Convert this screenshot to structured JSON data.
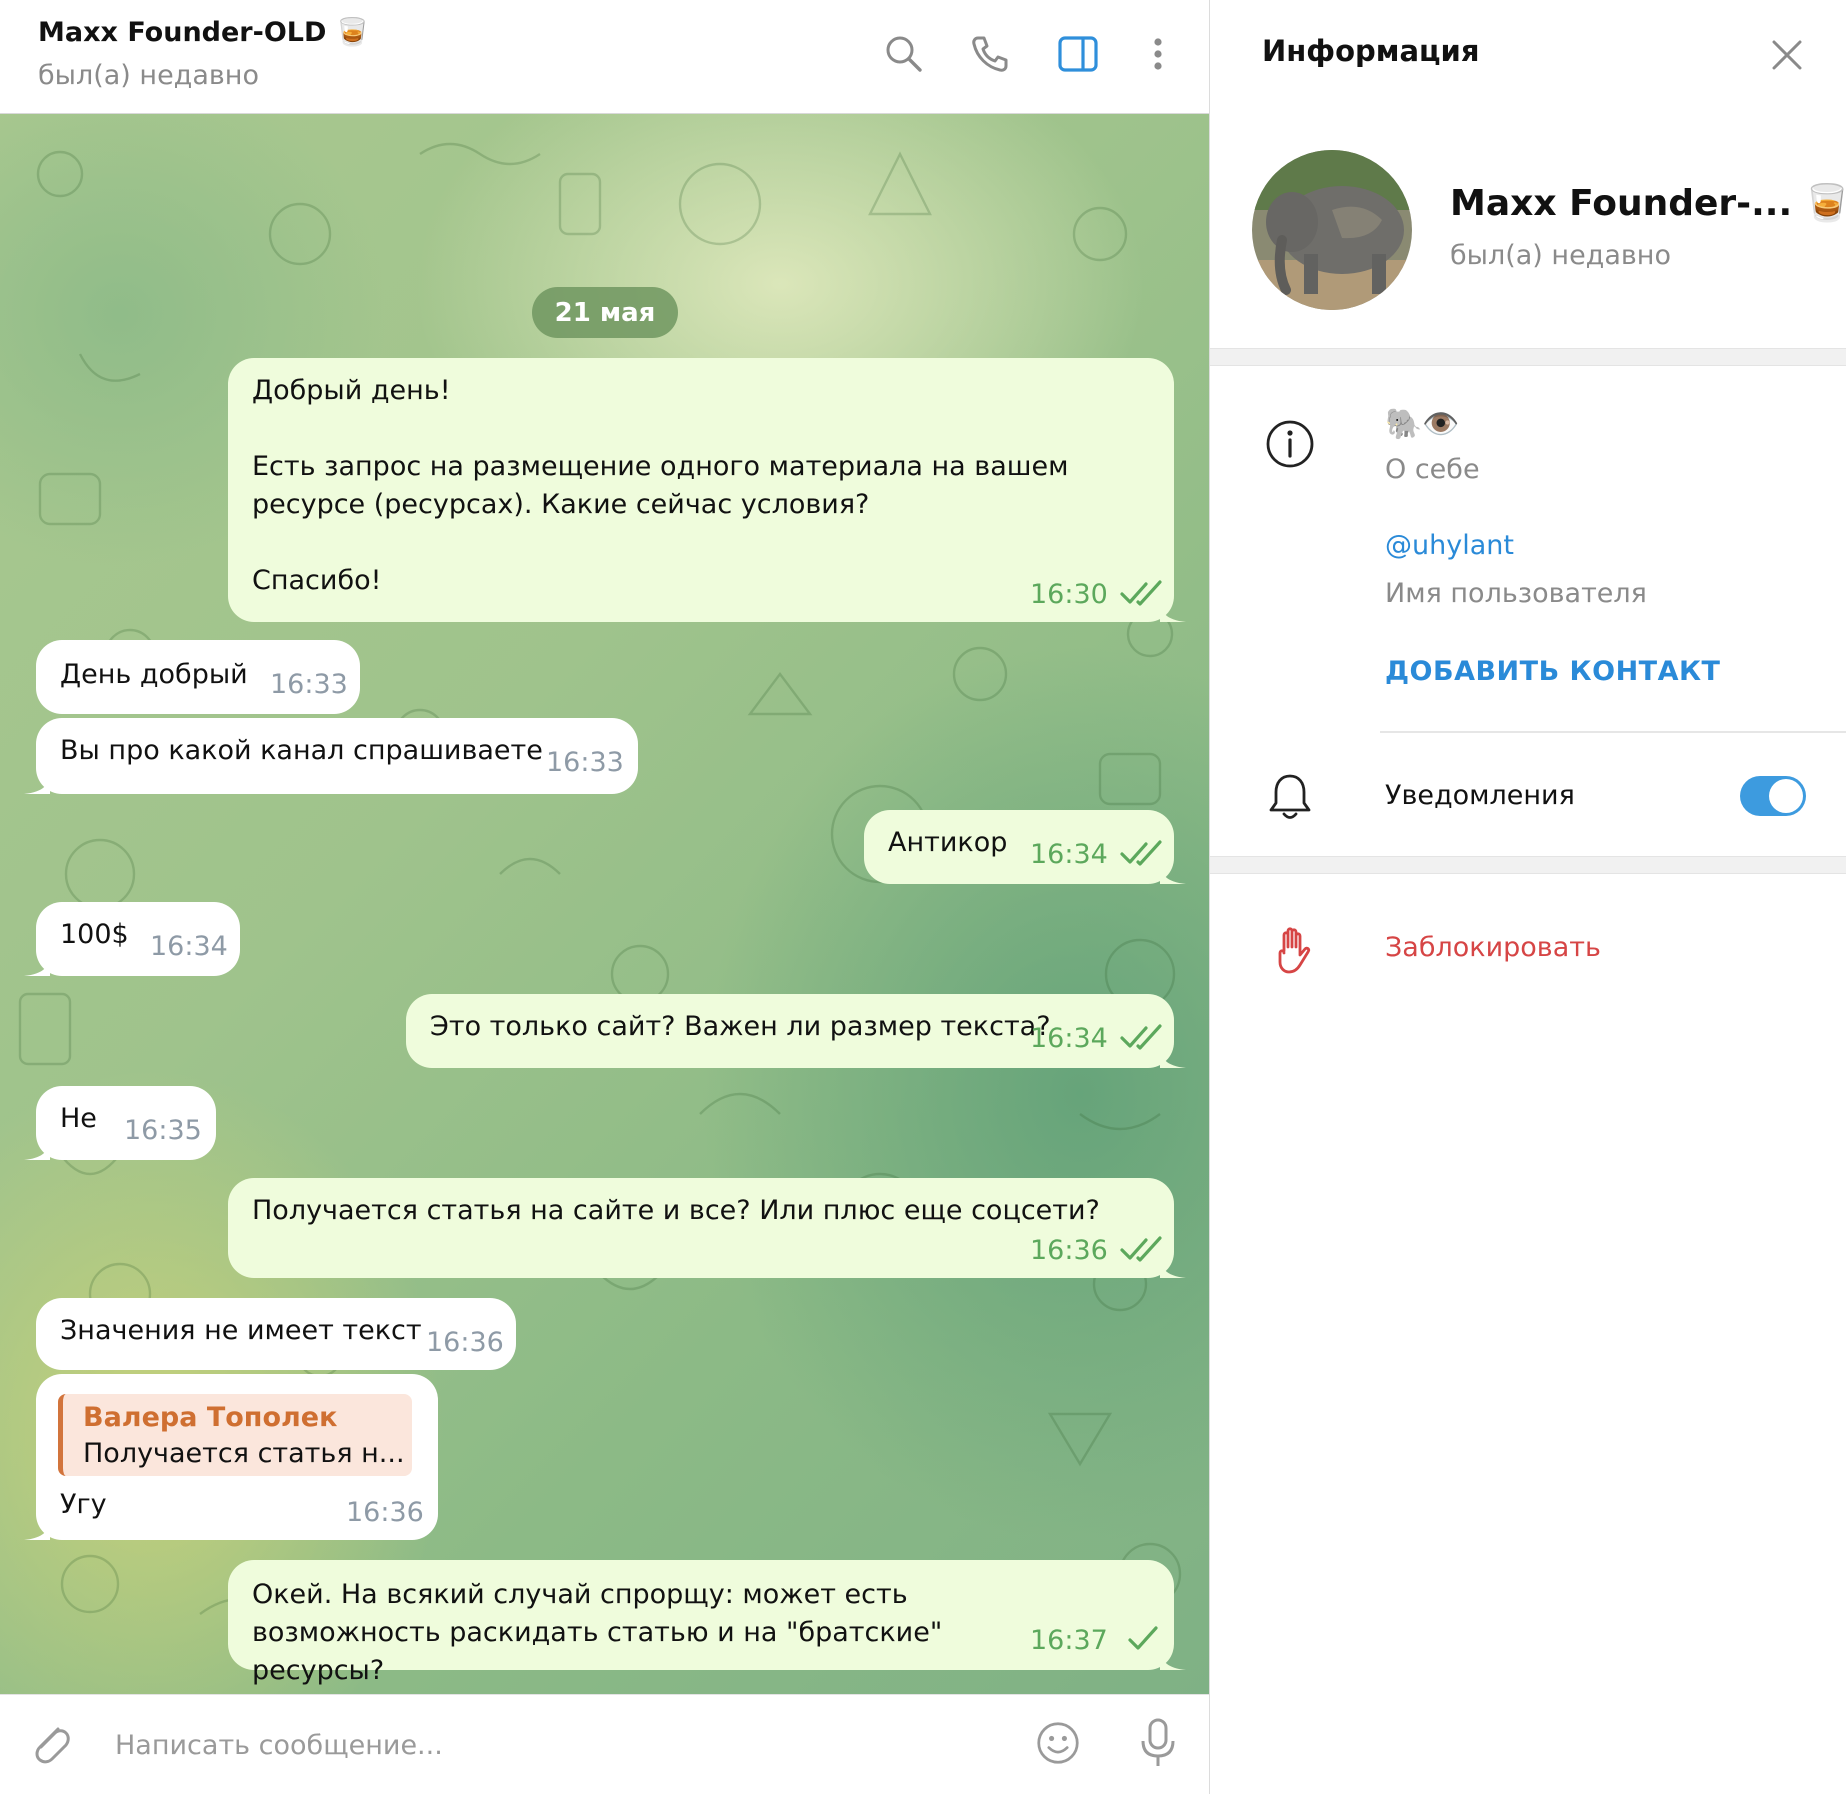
{
  "chat": {
    "title": "Maxx Founder-OLD 🥃",
    "status": "был(а) недавно",
    "date_separator": "21 мая",
    "messages": [
      {
        "dir": "out",
        "text": "Добрый день!\n\nЕсть запрос на размещение одного материала на вашем ресурсе (ресурсах). Какие сейчас условия?\n\nСпасибо!",
        "time": "16:30",
        "status": "read"
      },
      {
        "dir": "in",
        "text": "День добрый",
        "time": "16:33"
      },
      {
        "dir": "in",
        "text": "Вы про какой канал спрашиваете",
        "time": "16:33"
      },
      {
        "dir": "out",
        "text": "Антикор",
        "time": "16:34",
        "status": "read"
      },
      {
        "dir": "in",
        "text": "100$",
        "time": "16:34"
      },
      {
        "dir": "out",
        "text": "Это только сайт? Важен ли размер текста?",
        "time": "16:34",
        "status": "read"
      },
      {
        "dir": "in",
        "text": "Не",
        "time": "16:35"
      },
      {
        "dir": "out",
        "text": "Получается статья на сайте и все? Или плюс еще соцсети?",
        "time": "16:36",
        "status": "read"
      },
      {
        "dir": "in",
        "text": "Значения не имеет текст",
        "time": "16:36"
      },
      {
        "dir": "in",
        "reply_to": {
          "name": "Валера Тополек",
          "text": "Получается статья н..."
        },
        "text": "Угу",
        "time": "16:36"
      },
      {
        "dir": "out",
        "text": "Окей. На всякий случай спрорщу: может есть возможность раскидать статью и на \"братские\" ресурсы?",
        "time": "16:37",
        "status": "sent"
      }
    ],
    "composer_placeholder": "Написать сообщение..."
  },
  "info_panel": {
    "title": "Информация",
    "profile_name": "Maxx Founder-... 🥃",
    "profile_status": "был(а) недавно",
    "bio": "🐘👁️",
    "bio_label": "О себе",
    "username": "@uhylant",
    "username_label": "Имя пользователя",
    "add_contact": "ДОБАВИТЬ КОНТАКТ",
    "notifications_label": "Уведомления",
    "notifications_enabled": true,
    "block_label": "Заблокировать"
  },
  "colors": {
    "accent": "#2a8ad8",
    "outgoing_bubble": "#effcdc",
    "incoming_bubble": "#ffffff",
    "read_tick": "#5ca85c",
    "danger": "#d64545",
    "reply_name": "#cf6f31"
  },
  "icons": [
    "search-icon",
    "phone-icon",
    "sidebar-toggle-icon",
    "more-vertical-icon",
    "close-icon",
    "info-icon",
    "bell-icon",
    "hand-block-icon",
    "paperclip-icon",
    "emoji-icon",
    "microphone-icon",
    "double-check-icon",
    "single-check-icon"
  ]
}
